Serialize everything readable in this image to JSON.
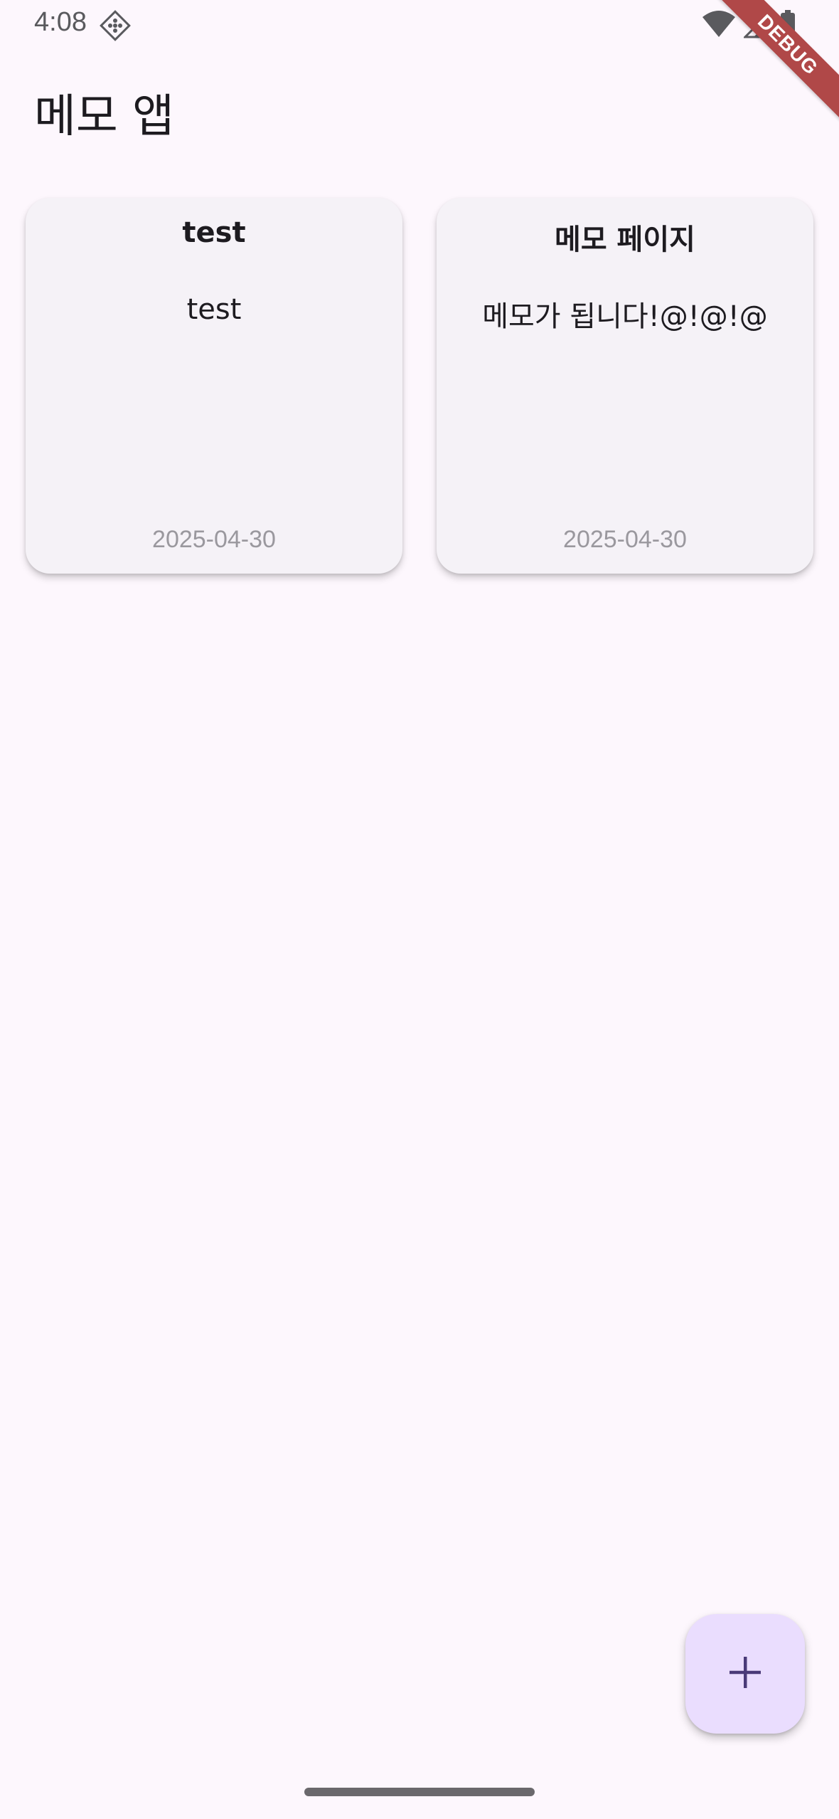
{
  "status_bar": {
    "time": "4:08",
    "icons": [
      "app-notification-icon",
      "wifi-icon",
      "signal-icon",
      "battery-icon"
    ]
  },
  "debug_banner": "DEBUG",
  "app_bar": {
    "title": "메모 앱"
  },
  "memos": [
    {
      "title": "test",
      "body": "test",
      "date": "2025-04-30"
    },
    {
      "title": "메모 페이지",
      "body": "메모가 됩니다!@!@!@",
      "date": "2025-04-30"
    }
  ],
  "fab": {
    "icon": "plus-icon"
  },
  "colors": {
    "background": "#fdf7fd",
    "card": "#f5f2f7",
    "fab": "#eaddfe",
    "fab_icon": "#4a3a78",
    "date_text": "#9a989e",
    "debug_ribbon": "#b04848"
  }
}
